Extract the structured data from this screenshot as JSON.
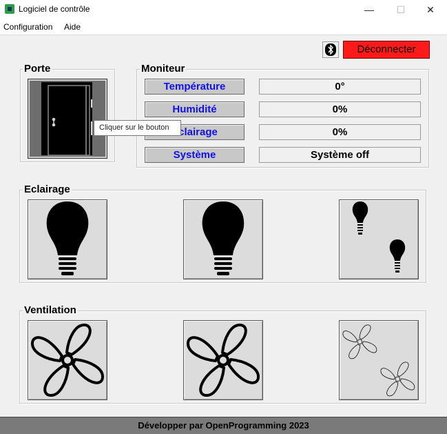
{
  "window": {
    "title": "Logiciel de contrôle",
    "minimize": "—",
    "maximize": "☐",
    "close": "✕"
  },
  "menu": {
    "items": [
      "Configuration",
      "Aide"
    ]
  },
  "toolbar": {
    "bluetooth_icon": "bluetooth-icon",
    "disconnect_label": "Déconnecter",
    "disconnect_color": "#ff1a1a"
  },
  "porte": {
    "label": "Porte",
    "tooltip": "Cliquer sur le bouton",
    "door_icon": "door-icon"
  },
  "moniteur": {
    "label": "Moniteur",
    "rows": [
      {
        "button": "Température",
        "value": "0°"
      },
      {
        "button": "Humidité",
        "value": "0%"
      },
      {
        "button": "Eclairage",
        "value": "0%"
      },
      {
        "button": "Système",
        "value": "Système off"
      }
    ],
    "button_text_color": "#1010e8"
  },
  "eclairage": {
    "label": "Eclairage",
    "buttons": [
      "bulb-icon",
      "bulb-icon",
      "bulbs-pair-icon"
    ]
  },
  "ventilation": {
    "label": "Ventilation",
    "buttons": [
      "fan-icon",
      "fan-icon",
      "fans-pair-outline-icon"
    ]
  },
  "footer": {
    "text": "Développer par OpenProgramming 2023"
  }
}
